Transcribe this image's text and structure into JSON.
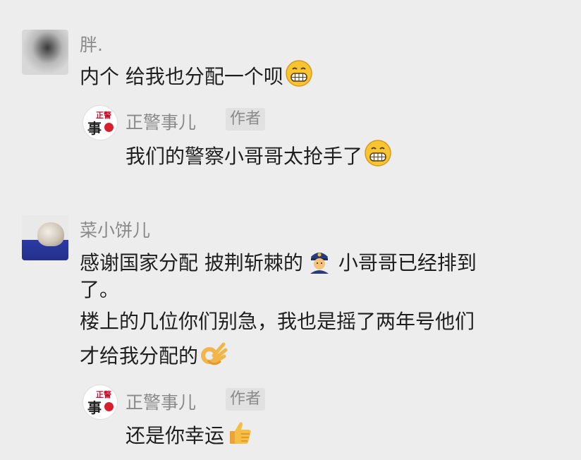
{
  "comments": [
    {
      "user": "胖.",
      "text_before_emoji": "内个 给我也分配一个呗",
      "emoji": "grinning-face-icon",
      "reply": {
        "user": "正警事儿",
        "tag": "作者",
        "text": "我们的警察小哥哥太抢手了",
        "emoji": "grinning-face-icon"
      }
    },
    {
      "user": "菜小饼儿",
      "lines": [
        "感谢国家分配 披荆斩棘的",
        "小哥哥已经排到",
        "了。",
        "楼上的几位你们别急，我也是摇了两年号他们",
        "才给我分配的"
      ],
      "emoji_police": "police-officer-icon",
      "emoji_ok": "ok-hand-icon",
      "reply": {
        "user": "正警事儿",
        "tag": "作者",
        "text": "还是你幸运",
        "emoji": "thumbs-up-icon"
      }
    }
  ],
  "author_avatar": {
    "top": "正警",
    "main": "事"
  },
  "colors": {
    "background": "#ededed",
    "name": "#8a8a8a",
    "text": "#1e1e1e",
    "badge_red": "#d6202e"
  }
}
